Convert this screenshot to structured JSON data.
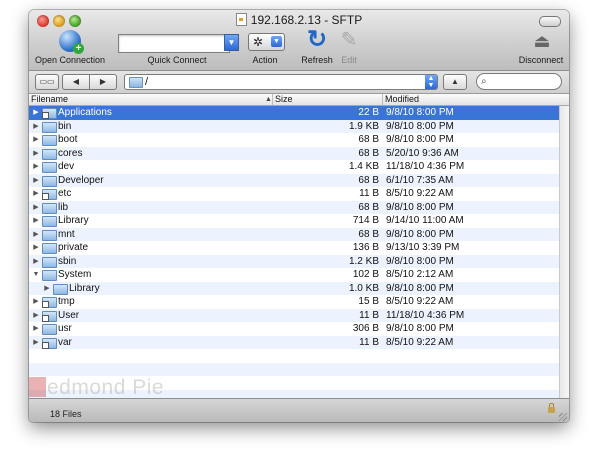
{
  "window": {
    "title": "192.168.2.13 - SFTP"
  },
  "toolbar": {
    "open_connection": "Open Connection",
    "quick_connect": "Quick Connect",
    "action": "Action",
    "refresh": "Refresh",
    "edit": "Edit",
    "disconnect": "Disconnect",
    "quick_connect_value": ""
  },
  "navbar": {
    "path": "/",
    "search_value": ""
  },
  "columns": {
    "filename": "Filename",
    "size": "Size",
    "modified": "Modified"
  },
  "files": [
    {
      "name": "Applications",
      "size": "22 B",
      "modified": "9/8/10 8:00 PM",
      "selected": true,
      "expanded": false,
      "indent": 0,
      "badge": true
    },
    {
      "name": "bin",
      "size": "1.9 KB",
      "modified": "9/8/10 8:00 PM",
      "selected": false,
      "expanded": false,
      "indent": 0,
      "badge": false
    },
    {
      "name": "boot",
      "size": "68 B",
      "modified": "9/8/10 8:00 PM",
      "selected": false,
      "expanded": false,
      "indent": 0,
      "badge": false
    },
    {
      "name": "cores",
      "size": "68 B",
      "modified": "5/20/10 9:36 AM",
      "selected": false,
      "expanded": false,
      "indent": 0,
      "badge": false
    },
    {
      "name": "dev",
      "size": "1.4 KB",
      "modified": "11/18/10 4:36 PM",
      "selected": false,
      "expanded": false,
      "indent": 0,
      "badge": false
    },
    {
      "name": "Developer",
      "size": "68 B",
      "modified": "6/1/10 7:35 AM",
      "selected": false,
      "expanded": false,
      "indent": 0,
      "badge": false
    },
    {
      "name": "etc",
      "size": "11 B",
      "modified": "8/5/10 9:22 AM",
      "selected": false,
      "expanded": false,
      "indent": 0,
      "badge": true
    },
    {
      "name": "lib",
      "size": "68 B",
      "modified": "9/8/10 8:00 PM",
      "selected": false,
      "expanded": false,
      "indent": 0,
      "badge": false
    },
    {
      "name": "Library",
      "size": "714 B",
      "modified": "9/14/10 11:00 AM",
      "selected": false,
      "expanded": false,
      "indent": 0,
      "badge": false
    },
    {
      "name": "mnt",
      "size": "68 B",
      "modified": "9/8/10 8:00 PM",
      "selected": false,
      "expanded": false,
      "indent": 0,
      "badge": false
    },
    {
      "name": "private",
      "size": "136 B",
      "modified": "9/13/10 3:39 PM",
      "selected": false,
      "expanded": false,
      "indent": 0,
      "badge": false
    },
    {
      "name": "sbin",
      "size": "1.2 KB",
      "modified": "9/8/10 8:00 PM",
      "selected": false,
      "expanded": false,
      "indent": 0,
      "badge": false
    },
    {
      "name": "System",
      "size": "102 B",
      "modified": "8/5/10 2:12 AM",
      "selected": false,
      "expanded": true,
      "indent": 0,
      "badge": false
    },
    {
      "name": "Library",
      "size": "1.0 KB",
      "modified": "9/8/10 8:00 PM",
      "selected": false,
      "expanded": false,
      "indent": 1,
      "badge": false
    },
    {
      "name": "tmp",
      "size": "15 B",
      "modified": "8/5/10 9:22 AM",
      "selected": false,
      "expanded": false,
      "indent": 0,
      "badge": true
    },
    {
      "name": "User",
      "size": "11 B",
      "modified": "11/18/10 4:36 PM",
      "selected": false,
      "expanded": false,
      "indent": 0,
      "badge": true
    },
    {
      "name": "usr",
      "size": "306 B",
      "modified": "9/8/10 8:00 PM",
      "selected": false,
      "expanded": false,
      "indent": 0,
      "badge": false
    },
    {
      "name": "var",
      "size": "11 B",
      "modified": "8/5/10 9:22 AM",
      "selected": false,
      "expanded": false,
      "indent": 0,
      "badge": true
    }
  ],
  "status": {
    "file_count": "18 Files"
  },
  "watermark": {
    "text": "edmond Pie"
  },
  "colors": {
    "selection": "#3875d7",
    "alt_row": "#edf3fe",
    "folder": "#8fb8e3"
  }
}
